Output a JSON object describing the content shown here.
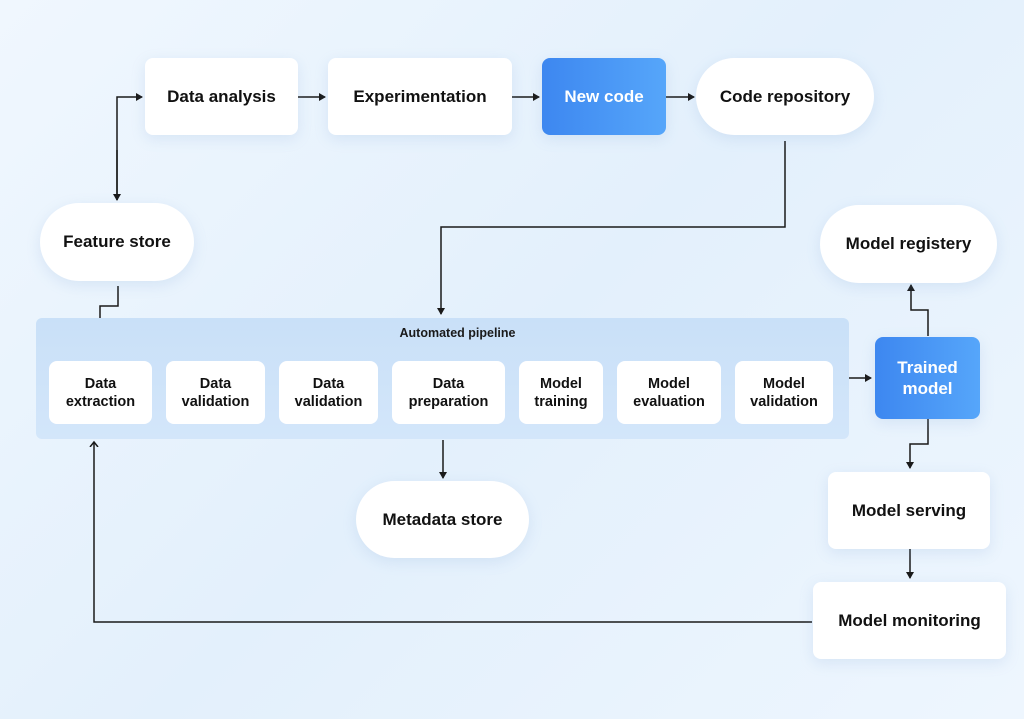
{
  "diagram": {
    "top_row": {
      "data_analysis": "Data analysis",
      "experimentation": "Experimentation",
      "new_code": "New code",
      "code_repository": "Code repository"
    },
    "feature_store": "Feature store",
    "model_registry": "Model registery",
    "pipeline": {
      "label": "Automated pipeline",
      "steps": [
        {
          "line1": "Data",
          "line2": "extraction"
        },
        {
          "line1": "Data",
          "line2": "validation"
        },
        {
          "line1": "Data",
          "line2": "validation"
        },
        {
          "line1": "Data",
          "line2": "preparation"
        },
        {
          "line1": "Model",
          "line2": "training"
        },
        {
          "line1": "Model",
          "line2": "evaluation"
        },
        {
          "line1": "Model",
          "line2": "validation"
        }
      ]
    },
    "trained_model": {
      "line1": "Trained",
      "line2": "model"
    },
    "metadata_store": "Metadata store",
    "model_serving": "Model serving",
    "model_monitoring": "Model monitoring",
    "colors": {
      "accent_start": "#3d87f0",
      "accent_end": "#56a6fa",
      "pipeline_bg": "#cde3f9",
      "edge": "#1a1a1a"
    }
  }
}
